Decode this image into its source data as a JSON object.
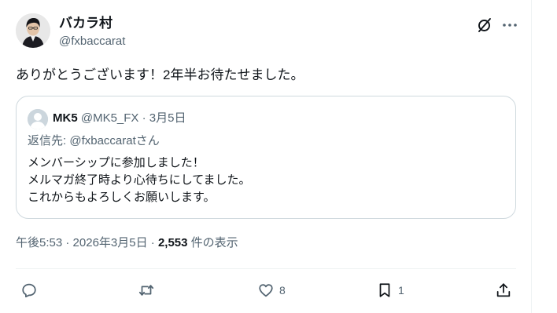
{
  "author": {
    "name": "バカラ村",
    "handle": "@fxbaccarat"
  },
  "post": {
    "text": "ありがとうございます！2年半お待たせました。"
  },
  "quote": {
    "name": "MK5",
    "handle": "@MK5_FX",
    "separator": "·",
    "date": "3月5日",
    "reply_prefix": "返信先: ",
    "reply_mention": "@fxbaccarat",
    "reply_suffix": "さん",
    "lines": [
      "メンバーシップに参加しました！",
      "メルマガ終了時より心待ちにしてました。",
      "これからもよろしくお願いします。"
    ]
  },
  "meta": {
    "time": "午後5:53",
    "sep1": " · ",
    "date": "2026年3月5日",
    "sep2": " · ",
    "views": "2,553",
    "views_label": " 件の表示"
  },
  "actions": {
    "reply_count": "",
    "repost_count": "",
    "like_count": "8",
    "bookmark_count": "1"
  },
  "icons": {
    "grok": "grok-icon",
    "more": "more-icon",
    "reply": "reply-icon",
    "repost": "repost-icon",
    "like": "heart-icon",
    "bookmark": "bookmark-icon",
    "share": "share-icon"
  },
  "colors": {
    "text": "#0f1419",
    "secondary": "#536471",
    "border": "#cfd9de"
  }
}
